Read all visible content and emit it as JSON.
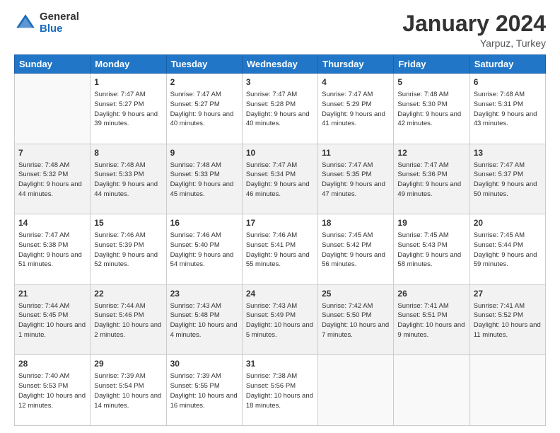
{
  "header": {
    "logo_general": "General",
    "logo_blue": "Blue",
    "month_title": "January 2024",
    "location": "Yarpuz, Turkey"
  },
  "days_of_week": [
    "Sunday",
    "Monday",
    "Tuesday",
    "Wednesday",
    "Thursday",
    "Friday",
    "Saturday"
  ],
  "weeks": [
    [
      {
        "day": "",
        "empty": true
      },
      {
        "day": "1",
        "sunrise": "Sunrise: 7:47 AM",
        "sunset": "Sunset: 5:27 PM",
        "daylight": "Daylight: 9 hours and 39 minutes."
      },
      {
        "day": "2",
        "sunrise": "Sunrise: 7:47 AM",
        "sunset": "Sunset: 5:27 PM",
        "daylight": "Daylight: 9 hours and 40 minutes."
      },
      {
        "day": "3",
        "sunrise": "Sunrise: 7:47 AM",
        "sunset": "Sunset: 5:28 PM",
        "daylight": "Daylight: 9 hours and 40 minutes."
      },
      {
        "day": "4",
        "sunrise": "Sunrise: 7:47 AM",
        "sunset": "Sunset: 5:29 PM",
        "daylight": "Daylight: 9 hours and 41 minutes."
      },
      {
        "day": "5",
        "sunrise": "Sunrise: 7:48 AM",
        "sunset": "Sunset: 5:30 PM",
        "daylight": "Daylight: 9 hours and 42 minutes."
      },
      {
        "day": "6",
        "sunrise": "Sunrise: 7:48 AM",
        "sunset": "Sunset: 5:31 PM",
        "daylight": "Daylight: 9 hours and 43 minutes."
      }
    ],
    [
      {
        "day": "7",
        "sunrise": "Sunrise: 7:48 AM",
        "sunset": "Sunset: 5:32 PM",
        "daylight": "Daylight: 9 hours and 44 minutes."
      },
      {
        "day": "8",
        "sunrise": "Sunrise: 7:48 AM",
        "sunset": "Sunset: 5:33 PM",
        "daylight": "Daylight: 9 hours and 44 minutes."
      },
      {
        "day": "9",
        "sunrise": "Sunrise: 7:48 AM",
        "sunset": "Sunset: 5:33 PM",
        "daylight": "Daylight: 9 hours and 45 minutes."
      },
      {
        "day": "10",
        "sunrise": "Sunrise: 7:47 AM",
        "sunset": "Sunset: 5:34 PM",
        "daylight": "Daylight: 9 hours and 46 minutes."
      },
      {
        "day": "11",
        "sunrise": "Sunrise: 7:47 AM",
        "sunset": "Sunset: 5:35 PM",
        "daylight": "Daylight: 9 hours and 47 minutes."
      },
      {
        "day": "12",
        "sunrise": "Sunrise: 7:47 AM",
        "sunset": "Sunset: 5:36 PM",
        "daylight": "Daylight: 9 hours and 49 minutes."
      },
      {
        "day": "13",
        "sunrise": "Sunrise: 7:47 AM",
        "sunset": "Sunset: 5:37 PM",
        "daylight": "Daylight: 9 hours and 50 minutes."
      }
    ],
    [
      {
        "day": "14",
        "sunrise": "Sunrise: 7:47 AM",
        "sunset": "Sunset: 5:38 PM",
        "daylight": "Daylight: 9 hours and 51 minutes."
      },
      {
        "day": "15",
        "sunrise": "Sunrise: 7:46 AM",
        "sunset": "Sunset: 5:39 PM",
        "daylight": "Daylight: 9 hours and 52 minutes."
      },
      {
        "day": "16",
        "sunrise": "Sunrise: 7:46 AM",
        "sunset": "Sunset: 5:40 PM",
        "daylight": "Daylight: 9 hours and 54 minutes."
      },
      {
        "day": "17",
        "sunrise": "Sunrise: 7:46 AM",
        "sunset": "Sunset: 5:41 PM",
        "daylight": "Daylight: 9 hours and 55 minutes."
      },
      {
        "day": "18",
        "sunrise": "Sunrise: 7:45 AM",
        "sunset": "Sunset: 5:42 PM",
        "daylight": "Daylight: 9 hours and 56 minutes."
      },
      {
        "day": "19",
        "sunrise": "Sunrise: 7:45 AM",
        "sunset": "Sunset: 5:43 PM",
        "daylight": "Daylight: 9 hours and 58 minutes."
      },
      {
        "day": "20",
        "sunrise": "Sunrise: 7:45 AM",
        "sunset": "Sunset: 5:44 PM",
        "daylight": "Daylight: 9 hours and 59 minutes."
      }
    ],
    [
      {
        "day": "21",
        "sunrise": "Sunrise: 7:44 AM",
        "sunset": "Sunset: 5:45 PM",
        "daylight": "Daylight: 10 hours and 1 minute."
      },
      {
        "day": "22",
        "sunrise": "Sunrise: 7:44 AM",
        "sunset": "Sunset: 5:46 PM",
        "daylight": "Daylight: 10 hours and 2 minutes."
      },
      {
        "day": "23",
        "sunrise": "Sunrise: 7:43 AM",
        "sunset": "Sunset: 5:48 PM",
        "daylight": "Daylight: 10 hours and 4 minutes."
      },
      {
        "day": "24",
        "sunrise": "Sunrise: 7:43 AM",
        "sunset": "Sunset: 5:49 PM",
        "daylight": "Daylight: 10 hours and 5 minutes."
      },
      {
        "day": "25",
        "sunrise": "Sunrise: 7:42 AM",
        "sunset": "Sunset: 5:50 PM",
        "daylight": "Daylight: 10 hours and 7 minutes."
      },
      {
        "day": "26",
        "sunrise": "Sunrise: 7:41 AM",
        "sunset": "Sunset: 5:51 PM",
        "daylight": "Daylight: 10 hours and 9 minutes."
      },
      {
        "day": "27",
        "sunrise": "Sunrise: 7:41 AM",
        "sunset": "Sunset: 5:52 PM",
        "daylight": "Daylight: 10 hours and 11 minutes."
      }
    ],
    [
      {
        "day": "28",
        "sunrise": "Sunrise: 7:40 AM",
        "sunset": "Sunset: 5:53 PM",
        "daylight": "Daylight: 10 hours and 12 minutes."
      },
      {
        "day": "29",
        "sunrise": "Sunrise: 7:39 AM",
        "sunset": "Sunset: 5:54 PM",
        "daylight": "Daylight: 10 hours and 14 minutes."
      },
      {
        "day": "30",
        "sunrise": "Sunrise: 7:39 AM",
        "sunset": "Sunset: 5:55 PM",
        "daylight": "Daylight: 10 hours and 16 minutes."
      },
      {
        "day": "31",
        "sunrise": "Sunrise: 7:38 AM",
        "sunset": "Sunset: 5:56 PM",
        "daylight": "Daylight: 10 hours and 18 minutes."
      },
      {
        "day": "",
        "empty": true
      },
      {
        "day": "",
        "empty": true
      },
      {
        "day": "",
        "empty": true
      }
    ]
  ]
}
